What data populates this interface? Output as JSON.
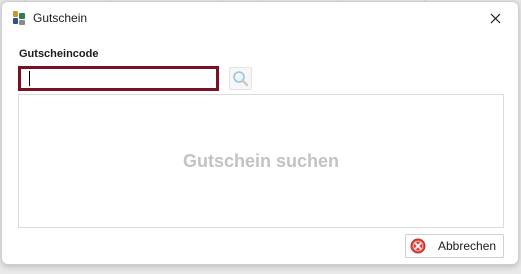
{
  "window": {
    "title": "Gutschein",
    "close_icon": "close-icon",
    "app_icon": "app-logo-icon"
  },
  "form": {
    "code_label": "Gutscheincode",
    "code_value": "",
    "search_icon": "search-magnifier-icon",
    "input_focus_color": "#7a1023"
  },
  "results": {
    "empty_text": "Gutschein suchen"
  },
  "footer": {
    "cancel_label": "Abbrechen",
    "cancel_icon": "cancel-x-icon",
    "cancel_icon_color": "#e0453a"
  }
}
